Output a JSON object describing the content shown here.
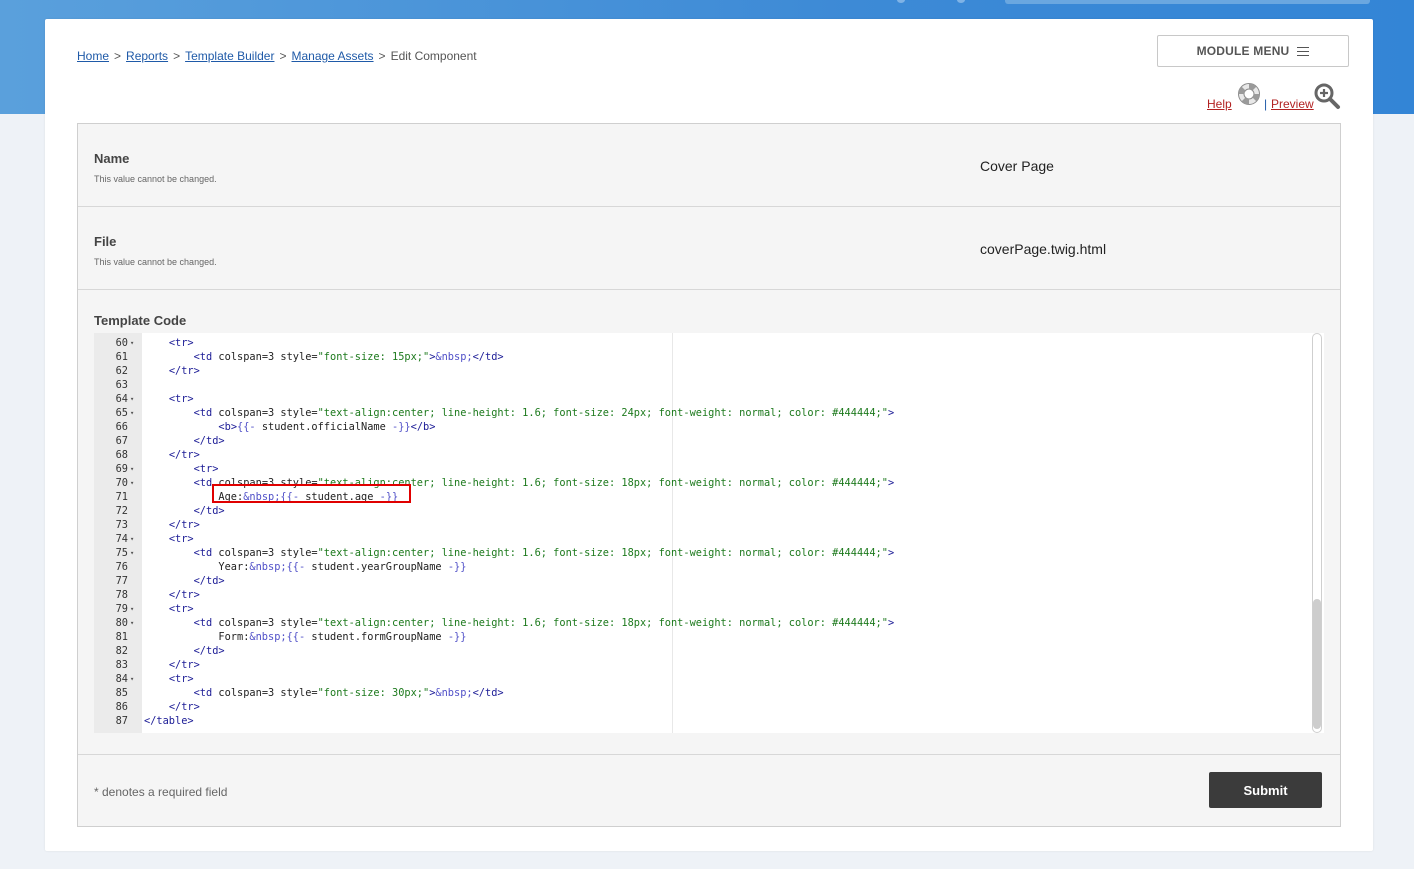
{
  "breadcrumb": {
    "items": [
      "Home",
      "Reports",
      "Template Builder",
      "Manage Assets"
    ],
    "current": "Edit Component",
    "separator": ">"
  },
  "module_menu": {
    "label": "MODULE MENU",
    "icon": "hamburger-icon"
  },
  "links": {
    "help": "Help",
    "divider": "|",
    "preview": "Preview"
  },
  "form": {
    "name": {
      "label": "Name",
      "hint": "This value cannot be changed.",
      "value": "Cover Page"
    },
    "file": {
      "label": "File",
      "hint": "This value cannot be changed.",
      "value": "coverPage.twig.html"
    },
    "template_code": {
      "label": "Template Code"
    },
    "required_note": "* denotes a required field",
    "submit_label": "Submit"
  },
  "editor": {
    "lines": [
      {
        "n": "60",
        "fold": true,
        "indent": 1,
        "code": "<tr>"
      },
      {
        "n": "61",
        "fold": false,
        "indent": 2,
        "code": "<td colspan=3 style=\"font-size: 15px;\">&nbsp;</td>"
      },
      {
        "n": "62",
        "fold": false,
        "indent": 1,
        "code": "</tr>"
      },
      {
        "n": "63",
        "fold": false,
        "indent": 0,
        "code": ""
      },
      {
        "n": "64",
        "fold": true,
        "indent": 1,
        "code": "<tr>"
      },
      {
        "n": "65",
        "fold": true,
        "indent": 2,
        "code": "<td colspan=3 style=\"text-align:center; line-height: 1.6; font-size: 24px; font-weight: normal; color: #444444;\">"
      },
      {
        "n": "66",
        "fold": false,
        "indent": 3,
        "code": "<b>{{- student.officialName -}}</b>"
      },
      {
        "n": "67",
        "fold": false,
        "indent": 2,
        "code": "</td>"
      },
      {
        "n": "68",
        "fold": false,
        "indent": 1,
        "code": "</tr>"
      },
      {
        "n": "69",
        "fold": true,
        "indent": 2,
        "code": "<tr>"
      },
      {
        "n": "70",
        "fold": true,
        "indent": 2,
        "code": "<td colspan=3 style=\"text-align:center; line-height: 1.6; font-size: 18px; font-weight: normal; color: #444444;\">"
      },
      {
        "n": "71",
        "fold": false,
        "indent": 3,
        "code": "Age:&nbsp;{{- student.age -}}"
      },
      {
        "n": "72",
        "fold": false,
        "indent": 2,
        "code": "</td>"
      },
      {
        "n": "73",
        "fold": false,
        "indent": 1,
        "code": "</tr>"
      },
      {
        "n": "74",
        "fold": true,
        "indent": 1,
        "code": "<tr>"
      },
      {
        "n": "75",
        "fold": true,
        "indent": 2,
        "code": "<td colspan=3 style=\"text-align:center; line-height: 1.6; font-size: 18px; font-weight: normal; color: #444444;\">"
      },
      {
        "n": "76",
        "fold": false,
        "indent": 3,
        "code": "Year:&nbsp;{{- student.yearGroupName -}}"
      },
      {
        "n": "77",
        "fold": false,
        "indent": 2,
        "code": "</td>"
      },
      {
        "n": "78",
        "fold": false,
        "indent": 1,
        "code": "</tr>"
      },
      {
        "n": "79",
        "fold": true,
        "indent": 1,
        "code": "<tr>"
      },
      {
        "n": "80",
        "fold": true,
        "indent": 2,
        "code": "<td colspan=3 style=\"text-align:center; line-height: 1.6; font-size: 18px; font-weight: normal; color: #444444;\">"
      },
      {
        "n": "81",
        "fold": false,
        "indent": 3,
        "code": "Form:&nbsp;{{- student.formGroupName -}}"
      },
      {
        "n": "82",
        "fold": false,
        "indent": 2,
        "code": "</td>"
      },
      {
        "n": "83",
        "fold": false,
        "indent": 1,
        "code": "</tr>"
      },
      {
        "n": "84",
        "fold": true,
        "indent": 1,
        "code": "<tr>"
      },
      {
        "n": "85",
        "fold": false,
        "indent": 2,
        "code": "<td colspan=3 style=\"font-size: 30px;\">&nbsp;</td>"
      },
      {
        "n": "86",
        "fold": false,
        "indent": 1,
        "code": "</tr>"
      },
      {
        "n": "87",
        "fold": false,
        "indent": 0,
        "code": "</table>"
      }
    ],
    "highlighted_line": "71"
  },
  "colors": {
    "header_blue": "#3d8ad6",
    "link_blue": "#1f5aa8",
    "help_red": "#b22222",
    "submit_bg": "#3b3b3b",
    "highlight_red": "#e00000"
  }
}
